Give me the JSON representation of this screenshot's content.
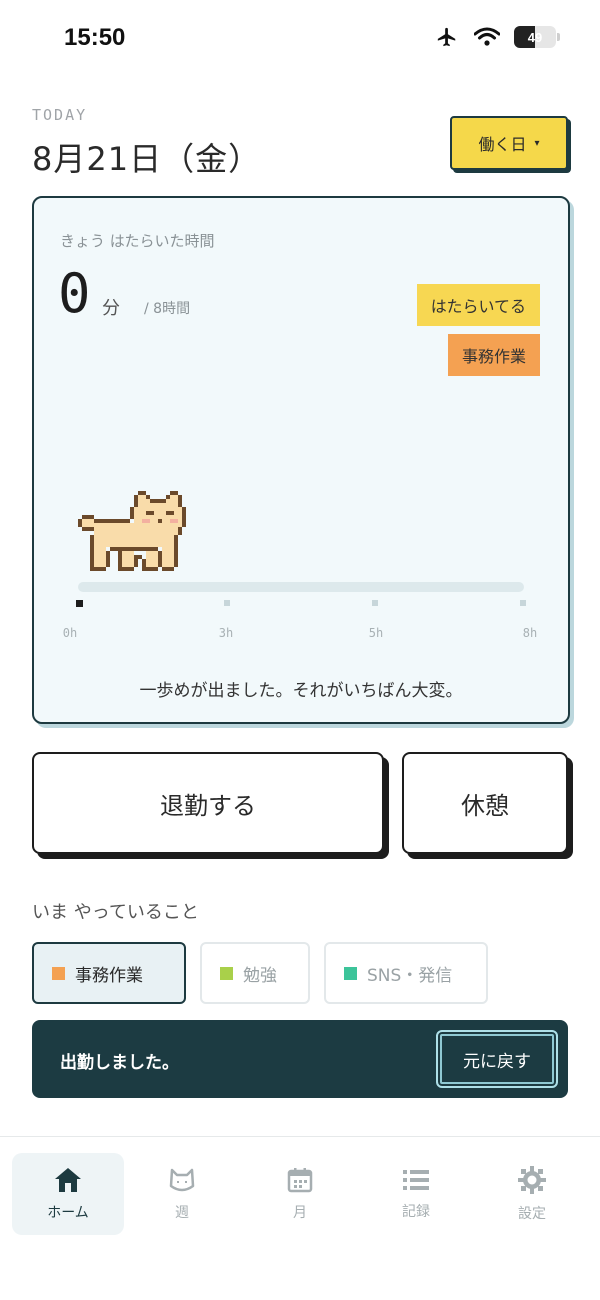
{
  "status_bar": {
    "time": "15:50",
    "battery": "49",
    "battery_level": 0.49
  },
  "header": {
    "today_label": "TODAY",
    "date": "8月21日（金）",
    "day_type": "働く日",
    "day_type_caret": "▾"
  },
  "card": {
    "worked_label": "きょう はたらいた時間",
    "minutes_value": "0",
    "minutes_unit": "分",
    "target": "/ 8時間",
    "badges": [
      "はたらいてる",
      "事務作業"
    ],
    "progress": 0,
    "ticks": [
      "0h",
      "3h",
      "5h",
      "8h"
    ],
    "message": "一歩めが出ました。それがいちばん大変。"
  },
  "actions": {
    "clock_out": "退勤する",
    "break": "休憩"
  },
  "activity": {
    "label": "いま やっていること",
    "chips": [
      {
        "label": "事務作業",
        "color": "#f4a152",
        "selected": true
      },
      {
        "label": "勉強",
        "color": "#a9d04a",
        "selected": false
      },
      {
        "label": "SNS・発信",
        "color": "#3cc49a",
        "selected": false
      }
    ]
  },
  "toast": {
    "message": "出勤しました。",
    "undo": "元に戻す"
  },
  "tabbar": {
    "tabs": [
      {
        "label": "ホーム",
        "icon": "home-icon",
        "active": true
      },
      {
        "label": "週",
        "icon": "cat-face-icon",
        "active": false
      },
      {
        "label": "月",
        "icon": "calendar-icon",
        "active": false
      },
      {
        "label": "記録",
        "icon": "list-icon",
        "active": false
      },
      {
        "label": "設定",
        "icon": "gear-icon",
        "active": false
      }
    ]
  },
  "colors": {
    "accent_dark": "#1d3a40",
    "yellow": "#f7d752",
    "orange": "#f4a152",
    "card_bg": "#f2f9fb"
  }
}
